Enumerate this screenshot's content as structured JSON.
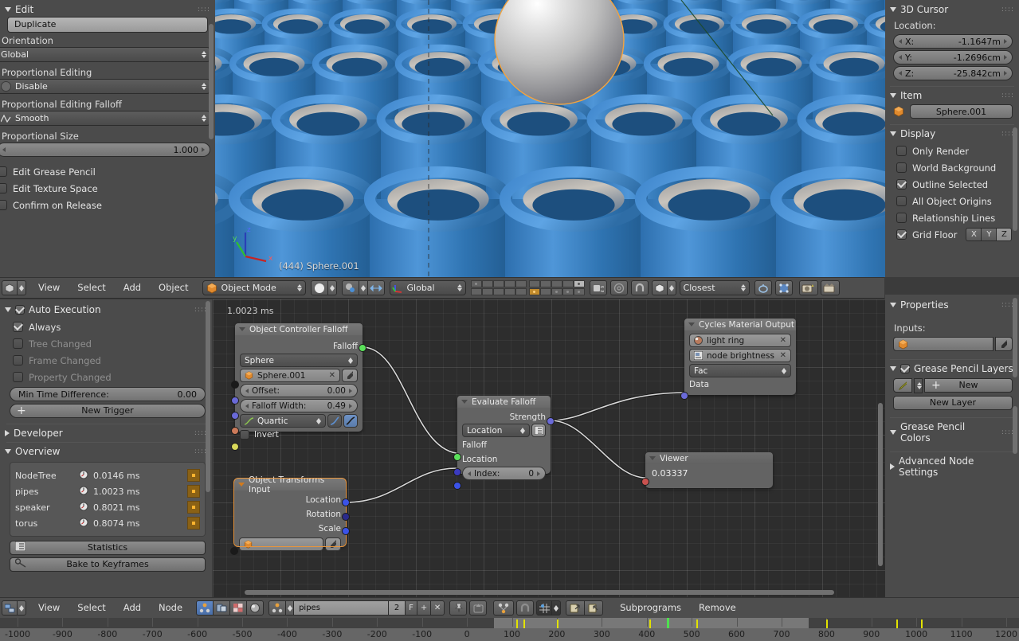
{
  "app": "Blender",
  "left_top_panel": {
    "title": "Edit",
    "duplicate_button": "Duplicate",
    "orientation_label": "Orientation",
    "orientation_value": "Global",
    "prop_edit_label": "Proportional Editing",
    "prop_edit_value": "Disable",
    "prop_falloff_label": "Proportional Editing Falloff",
    "prop_falloff_value": "Smooth",
    "prop_size_label": "Proportional Size",
    "prop_size_value": "1.000",
    "checkboxes": [
      {
        "label": "Edit Grease Pencil",
        "checked": false
      },
      {
        "label": "Edit Texture Space",
        "checked": false
      },
      {
        "label": "Confirm on Release",
        "checked": false
      }
    ]
  },
  "viewport": {
    "overlay_text": "(444) Sphere.001",
    "axis_labels": {
      "x": "x",
      "y": "y",
      "z": "z"
    },
    "bg_color": "#2f6fa8",
    "object_color": "#3f84c8",
    "selected_outline": "#f0a03c"
  },
  "viewport_header": {
    "menus": [
      "View",
      "Select",
      "Add",
      "Object"
    ],
    "mode": "Object Mode",
    "transform_orientation": "Global",
    "snap_mode": "Closest"
  },
  "right_top_panel": {
    "cursor": {
      "title": "3D Cursor",
      "location_label": "Location:",
      "fields": [
        {
          "axis": "X:",
          "value": "-1.1647m"
        },
        {
          "axis": "Y:",
          "value": "-1.2696cm"
        },
        {
          "axis": "Z:",
          "value": "-25.842cm"
        }
      ]
    },
    "item": {
      "title": "Item",
      "object_name": "Sphere.001"
    },
    "display": {
      "title": "Display",
      "options": [
        {
          "label": "Only Render",
          "checked": false
        },
        {
          "label": "World Background",
          "checked": false
        },
        {
          "label": "Outline Selected",
          "checked": true
        },
        {
          "label": "All Object Origins",
          "checked": false
        },
        {
          "label": "Relationship Lines",
          "checked": false
        },
        {
          "label": "Grid Floor",
          "checked": true
        }
      ],
      "axis_buttons": [
        {
          "label": "X",
          "active": false
        },
        {
          "label": "Y",
          "active": false
        },
        {
          "label": "Z",
          "active": true
        }
      ]
    }
  },
  "left_bottom_panel": {
    "auto_execution": {
      "title": "Auto Execution",
      "checked": true,
      "options": [
        {
          "label": "Always",
          "checked": true,
          "enabled": true
        },
        {
          "label": "Tree Changed",
          "checked": false,
          "enabled": false
        },
        {
          "label": "Frame Changed",
          "checked": false,
          "enabled": false
        },
        {
          "label": "Property Changed",
          "checked": false,
          "enabled": false
        }
      ],
      "min_time_label": "Min Time Difference:",
      "min_time_value": "0.00",
      "new_trigger": "New Trigger"
    },
    "developer": {
      "title": "Developer"
    },
    "overview": {
      "title": "Overview",
      "rows": [
        {
          "name": "NodeTree",
          "time": "0.0146 ms"
        },
        {
          "name": "pipes",
          "time": "1.0023 ms"
        },
        {
          "name": "speaker",
          "time": "0.8021 ms"
        },
        {
          "name": "torus",
          "time": "0.8074 ms"
        }
      ],
      "statistics_button": "Statistics",
      "bake_button": "Bake to Keyframes"
    }
  },
  "right_bottom_panel": {
    "properties": {
      "title": "Properties",
      "inputs_label": "Inputs:"
    },
    "grease_pencil_layers": {
      "title": "Grease Pencil Layers",
      "checked": true,
      "new_button": "New",
      "new_layer_button": "New Layer"
    },
    "grease_pencil_colors": {
      "title": "Grease Pencil Colors"
    },
    "advanced_node_settings": {
      "title": "Advanced Node Settings"
    }
  },
  "node_editor": {
    "exec_time": "1.0023 ms",
    "nodes": [
      {
        "id": "object-controller-falloff",
        "title": "Object Controller Falloff",
        "selected": false,
        "output_label": "Falloff",
        "object_mode": "Sphere",
        "object_name": "Sphere.001",
        "offset_label": "Offset:",
        "offset_value": "0.00",
        "width_label": "Falloff Width:",
        "width_value": "0.49",
        "interpolation": "Quartic",
        "invert_label": "Invert",
        "invert_checked": false
      },
      {
        "id": "object-transforms-input",
        "title": "Object Transforms Input",
        "selected": true,
        "outputs": [
          "Location",
          "Rotation",
          "Scale"
        ]
      },
      {
        "id": "evaluate-falloff",
        "title": "Evaluate Falloff",
        "selected": false,
        "output_label": "Strength",
        "mode": "Location",
        "inputs": [
          "Falloff",
          "Location"
        ],
        "index_label": "Index:",
        "index_value": "0"
      },
      {
        "id": "cycles-material-output",
        "title": "Cycles Material Output",
        "selected": false,
        "material": "light ring",
        "node_name": "node brightness",
        "socket": "Fac",
        "data_label": "Data"
      },
      {
        "id": "viewer",
        "title": "Viewer",
        "selected": false,
        "value": "0.03337"
      }
    ]
  },
  "node_header": {
    "menus": [
      "View",
      "Select",
      "Add",
      "Node"
    ],
    "tree_name": "pipes",
    "users_count": "2",
    "fake_user": "F",
    "subprograms": "Subprograms",
    "remove": "Remove"
  },
  "timeline": {
    "labels": [
      "-1000",
      "-900",
      "-800",
      "-700",
      "-600",
      "-500",
      "-400",
      "-300",
      "-200",
      "-100",
      "0",
      "100",
      "200",
      "300",
      "400",
      "500",
      "600",
      "700",
      "800",
      "900",
      "1000",
      "1100",
      "1200"
    ],
    "values": [
      -1000,
      -900,
      -800,
      -700,
      -600,
      -500,
      -400,
      -300,
      -200,
      -100,
      0,
      100,
      200,
      300,
      400,
      500,
      600,
      700,
      800,
      900,
      1000,
      1100,
      1200
    ],
    "current_frame": 444,
    "keyframes": [
      110,
      125,
      200,
      405,
      510,
      800,
      955,
      1010
    ],
    "range_start": 0,
    "range_end": 750
  }
}
